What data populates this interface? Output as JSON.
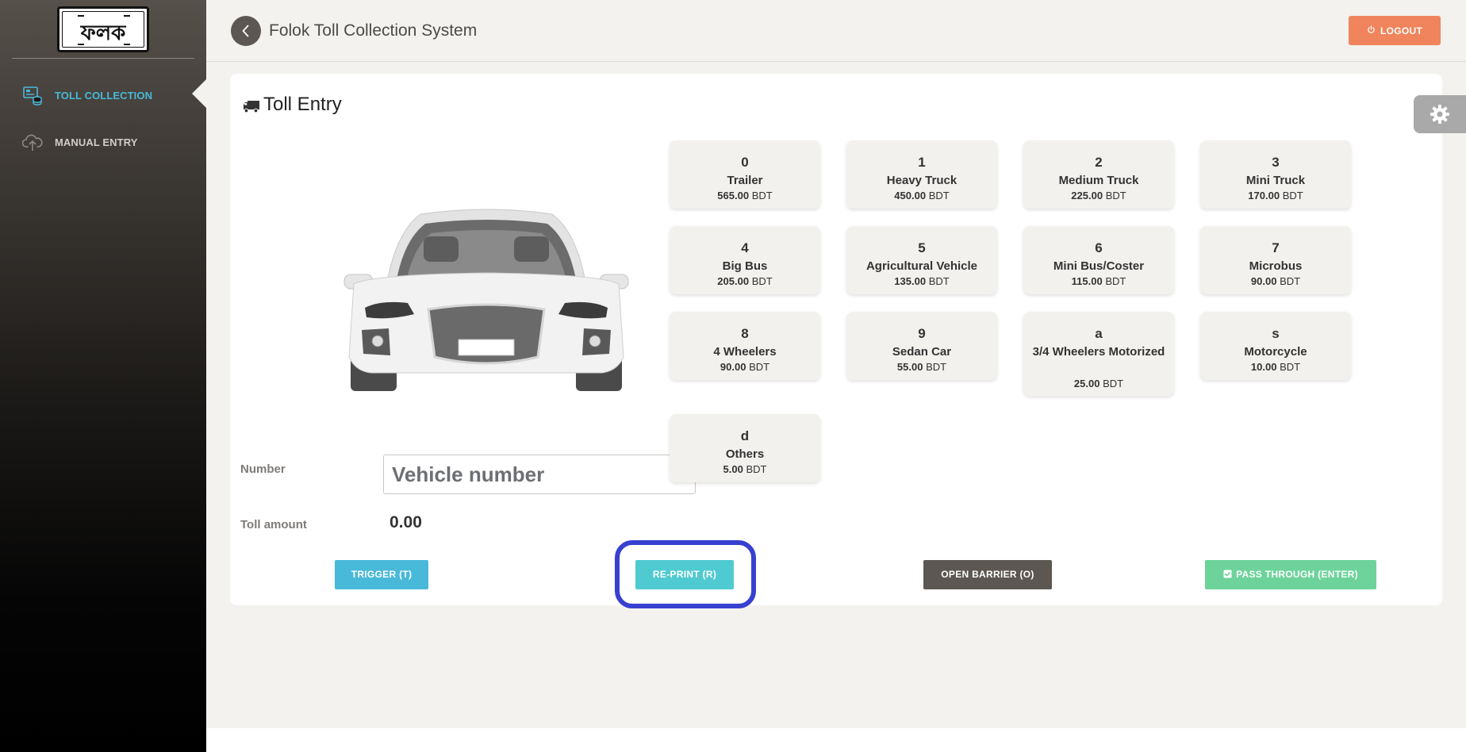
{
  "logo": {
    "text": "ফলক"
  },
  "sidebar": {
    "items": [
      {
        "label": "TOLL COLLECTION",
        "icon": "toll-collection-icon",
        "active": true
      },
      {
        "label": "MANUAL ENTRY",
        "icon": "cloud-upload-icon",
        "active": false
      }
    ]
  },
  "header": {
    "title": "Folok Toll Collection System",
    "logout_label": "LOGOUT"
  },
  "toll_entry": {
    "title": "Toll Entry",
    "number_label": "Number",
    "number_placeholder": "Vehicle number",
    "number_value": "",
    "toll_amount_label": "Toll amount",
    "toll_amount_value": "0.00"
  },
  "vehicle_types": [
    {
      "key": "0",
      "name": "Trailer",
      "price": "565.00",
      "currency": "BDT"
    },
    {
      "key": "1",
      "name": "Heavy Truck",
      "price": "450.00",
      "currency": "BDT"
    },
    {
      "key": "2",
      "name": "Medium Truck",
      "price": "225.00",
      "currency": "BDT"
    },
    {
      "key": "3",
      "name": "Mini Truck",
      "price": "170.00",
      "currency": "BDT"
    },
    {
      "key": "4",
      "name": "Big Bus",
      "price": "205.00",
      "currency": "BDT"
    },
    {
      "key": "5",
      "name": "Agricultural Vehicle",
      "price": "135.00",
      "currency": "BDT"
    },
    {
      "key": "6",
      "name": "Mini Bus/Coster",
      "price": "115.00",
      "currency": "BDT"
    },
    {
      "key": "7",
      "name": "Microbus",
      "price": "90.00",
      "currency": "BDT"
    },
    {
      "key": "8",
      "name": "4 Wheelers",
      "price": "90.00",
      "currency": "BDT"
    },
    {
      "key": "9",
      "name": "Sedan Car",
      "price": "55.00",
      "currency": "BDT"
    },
    {
      "key": "a",
      "name": "3/4 Wheelers Motorized",
      "price": "25.00",
      "currency": "BDT"
    },
    {
      "key": "s",
      "name": "Motorcycle",
      "price": "10.00",
      "currency": "BDT"
    },
    {
      "key": "d",
      "name": "Others",
      "price": "5.00",
      "currency": "BDT"
    }
  ],
  "actions": {
    "trigger": "TRIGGER (T)",
    "reprint": "RE-PRINT (R)",
    "open_barrier": "OPEN BARRIER (O)",
    "pass_through": "PASS THROUGH (ENTER)"
  },
  "colors": {
    "accent_blue": "#49b9d9",
    "reprint_teal": "#4fcad0",
    "barrier_dark": "#5c5752",
    "pass_green": "#6dd39b",
    "logout_orange": "#f0845c",
    "highlight_ring": "#3840d0"
  }
}
